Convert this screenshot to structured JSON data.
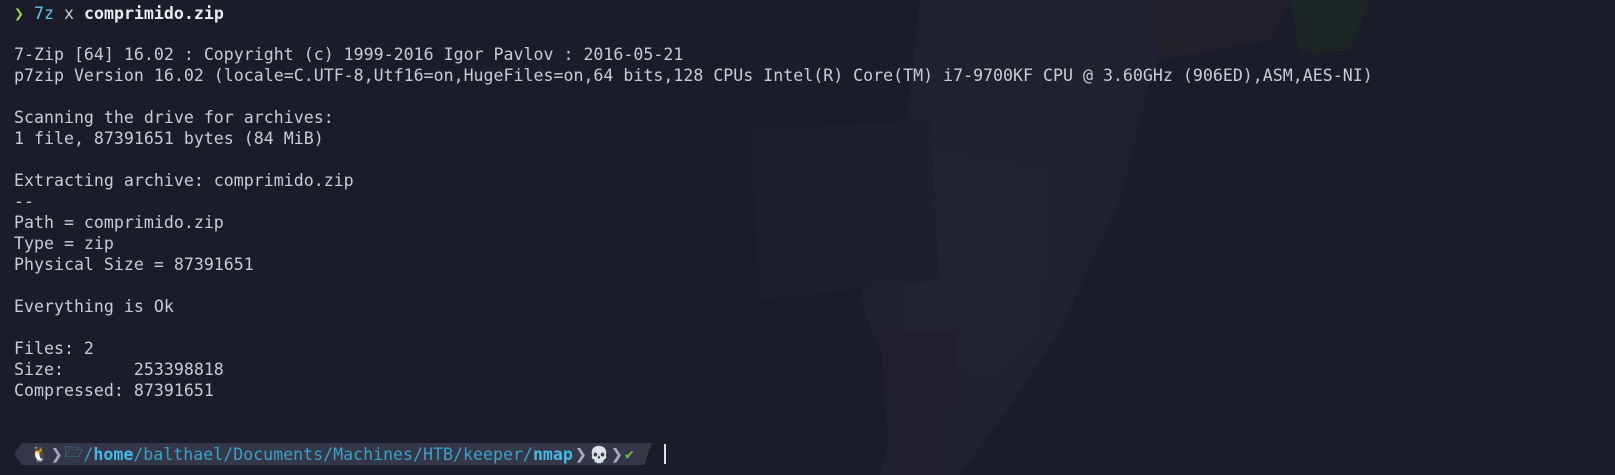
{
  "command": {
    "prompt_symbol": "❯",
    "name": "7z",
    "arg": "x",
    "file": "comprimido.zip"
  },
  "output": {
    "banner": "7-Zip [64] 16.02 : Copyright (c) 1999-2016 Igor Pavlov : 2016-05-21",
    "version_line": "p7zip Version 16.02 (locale=C.UTF-8,Utf16=on,HugeFiles=on,64 bits,128 CPUs Intel(R) Core(TM) i7-9700KF CPU @ 3.60GHz (906ED),ASM,AES-NI)",
    "scanning": "Scanning the drive for archives:",
    "scan_result": "1 file, 87391651 bytes (84 MiB)",
    "extracting": "Extracting archive: comprimido.zip",
    "separator": "--",
    "path": "Path = comprimido.zip",
    "type": "Type = zip",
    "physical_size": "Physical Size = 87391651",
    "status": "Everything is Ok",
    "files": "Files: 2",
    "size": "Size:       253398818",
    "compressed": "Compressed: 87391651"
  },
  "prompt": {
    "os_icon": "linux-tux-icon",
    "os_glyph": "🐧",
    "folder_icon": "folder-open-icon",
    "folder_glyph": "🗁",
    "path_parts": [
      "/",
      "home",
      "/balthael/Documents/Machines/HTB/keeper/",
      "nmap"
    ],
    "status_skull": "💀",
    "status_check": "✔"
  },
  "colors": {
    "background": "#1a1c2a",
    "text": "#c9ccd6",
    "prompt_arrow": "#8fd14f",
    "command": "#5fc8e8",
    "path": "#3aa0c8",
    "path_bold": "#46b8e8",
    "skull": "#e8b400",
    "check": "#6cc04a"
  }
}
